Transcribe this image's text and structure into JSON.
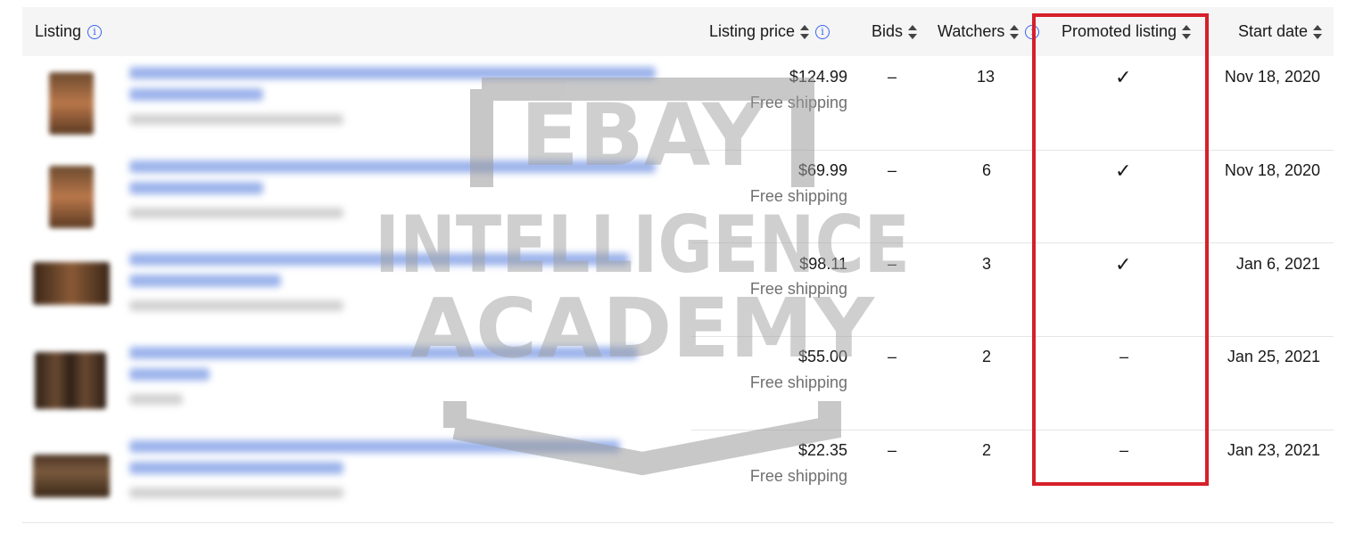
{
  "header": {
    "listing": "Listing",
    "listing_price": "Listing price",
    "bids": "Bids",
    "watchers": "Watchers",
    "promoted_listing": "Promoted listing",
    "start_date": "Start date"
  },
  "icons": {
    "info": "i",
    "check": "✓"
  },
  "rows": [
    {
      "price": "$124.99",
      "shipping": "Free shipping",
      "bids": "–",
      "watchers": "13",
      "promoted": "✓",
      "start_date": "Nov 18, 2020"
    },
    {
      "price": "$69.99",
      "shipping": "Free shipping",
      "bids": "–",
      "watchers": "6",
      "promoted": "✓",
      "start_date": "Nov 18, 2020"
    },
    {
      "price": "$98.11",
      "shipping": "Free shipping",
      "bids": "–",
      "watchers": "3",
      "promoted": "✓",
      "start_date": "Jan 6, 2021"
    },
    {
      "price": "$55.00",
      "shipping": "Free shipping",
      "bids": "–",
      "watchers": "2",
      "promoted": "–",
      "start_date": "Jan 25, 2021"
    },
    {
      "price": "$22.35",
      "shipping": "Free shipping",
      "bids": "–",
      "watchers": "2",
      "promoted": "–",
      "start_date": "Jan 23, 2021"
    }
  ],
  "watermark": {
    "line1": "EBAY",
    "line2": "INTELLIGENCE",
    "line3": "ACADEMY"
  },
  "colors": {
    "header_bg": "#f5f5f5",
    "highlight": "#d6202a",
    "info_blue": "#3665f3",
    "shipping_gray": "#707070"
  }
}
